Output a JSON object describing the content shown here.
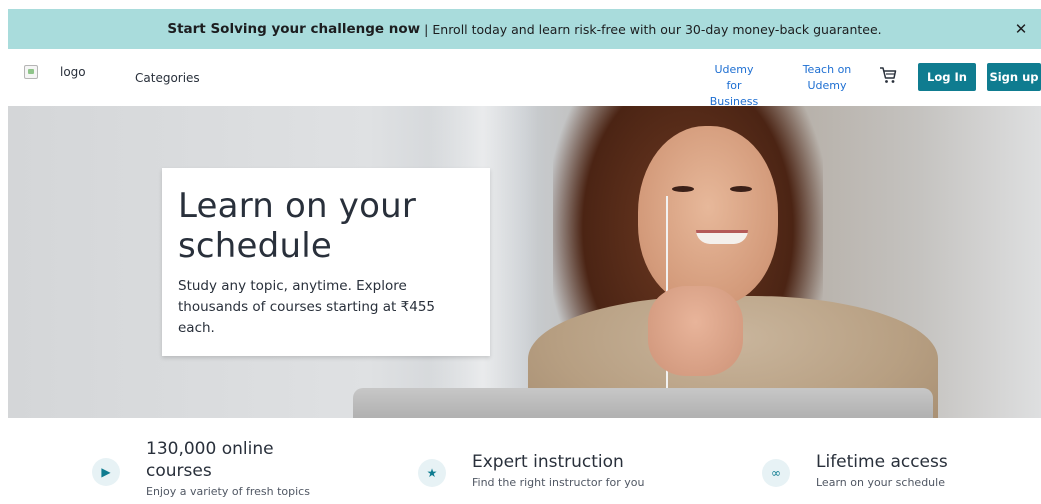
{
  "banner": {
    "headline": "Start Solving your challenge now",
    "separator": "|",
    "message": "Enroll today and learn risk-free with our 30-day money-back guarantee.",
    "close_icon": "close-icon",
    "close_glyph": "✕"
  },
  "header": {
    "logo_alt": "logo",
    "categories": "Categories",
    "business_line1": "Udemy for",
    "business_line2": "Business",
    "teach_line1": "Teach on",
    "teach_line2": "Udemy",
    "cart_icon": "cart-icon",
    "login": "Log In",
    "signup": "Sign up",
    "brand_color": "#0f7c90",
    "link_color": "#1e6fd2"
  },
  "hero": {
    "title": "Learn on your schedule",
    "subtitle": "Study any topic, anytime. Explore thousands of courses starting at ₹455 each."
  },
  "features": [
    {
      "icon": "play-icon",
      "glyph": "▶",
      "title": "130,000 online courses",
      "subtitle": "Enjoy a variety of fresh topics"
    },
    {
      "icon": "star-icon",
      "glyph": "★",
      "title": "Expert instruction",
      "subtitle": "Find the right instructor for you"
    },
    {
      "icon": "infinity-icon",
      "glyph": "∞",
      "title": "Lifetime access",
      "subtitle": "Learn on your schedule"
    }
  ]
}
